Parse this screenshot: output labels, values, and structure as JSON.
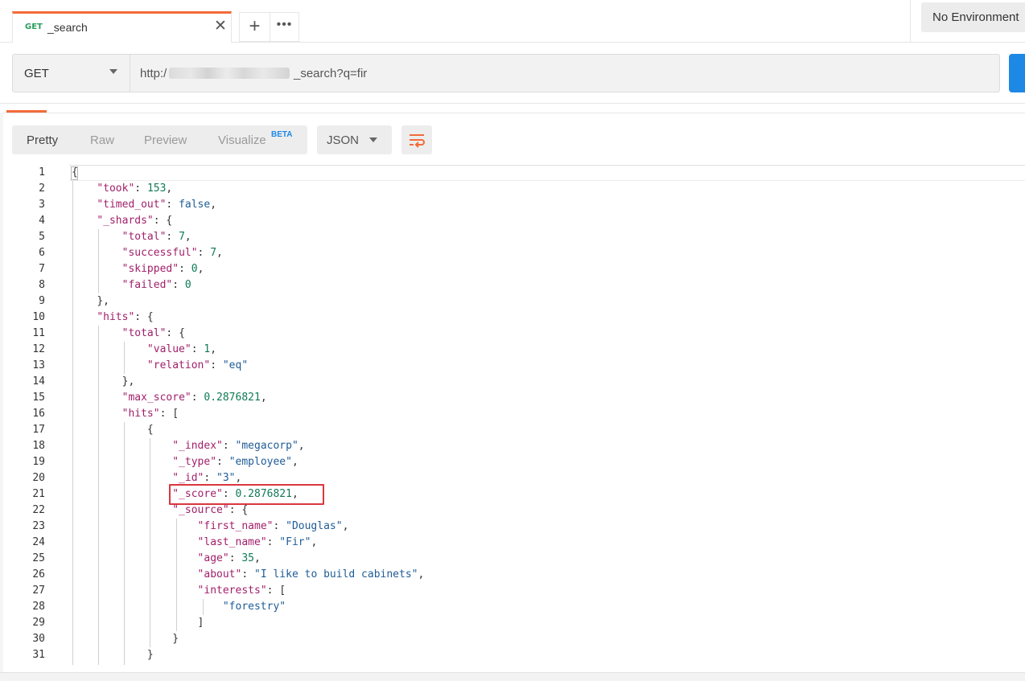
{
  "tab": {
    "method": "GET",
    "title": "_search",
    "close_glyph": "✕",
    "add_glyph": "+",
    "more_glyph": "•••"
  },
  "environment": {
    "label": "No Environment"
  },
  "request": {
    "method": "GET",
    "url_prefix": "http:/",
    "url_suffix": "_search?q=fir"
  },
  "response_toolbar": {
    "tabs": [
      {
        "label": "Pretty",
        "active": true
      },
      {
        "label": "Raw",
        "active": false
      },
      {
        "label": "Preview",
        "active": false
      },
      {
        "label": "Visualize",
        "active": false
      }
    ],
    "beta_label": "BETA",
    "format": "JSON"
  },
  "code_lines": [
    {
      "n": "1",
      "html": "<span class=\"p\">{</span>"
    },
    {
      "n": "2",
      "html": "    <span class=\"k\">\"took\"</span><span class=\"p\">: </span><span class=\"n\">153</span><span class=\"p\">,</span>"
    },
    {
      "n": "3",
      "html": "    <span class=\"k\">\"timed_out\"</span><span class=\"p\">: </span><span class=\"b\">false</span><span class=\"p\">,</span>"
    },
    {
      "n": "4",
      "html": "    <span class=\"k\">\"_shards\"</span><span class=\"p\">: {</span>"
    },
    {
      "n": "5",
      "html": "        <span class=\"k\">\"total\"</span><span class=\"p\">: </span><span class=\"n\">7</span><span class=\"p\">,</span>"
    },
    {
      "n": "6",
      "html": "        <span class=\"k\">\"successful\"</span><span class=\"p\">: </span><span class=\"n\">7</span><span class=\"p\">,</span>"
    },
    {
      "n": "7",
      "html": "        <span class=\"k\">\"skipped\"</span><span class=\"p\">: </span><span class=\"n\">0</span><span class=\"p\">,</span>"
    },
    {
      "n": "8",
      "html": "        <span class=\"k\">\"failed\"</span><span class=\"p\">: </span><span class=\"n\">0</span>"
    },
    {
      "n": "9",
      "html": "    <span class=\"p\">},</span>"
    },
    {
      "n": "10",
      "html": "    <span class=\"k\">\"hits\"</span><span class=\"p\">: {</span>"
    },
    {
      "n": "11",
      "html": "        <span class=\"k\">\"total\"</span><span class=\"p\">: {</span>"
    },
    {
      "n": "12",
      "html": "            <span class=\"k\">\"value\"</span><span class=\"p\">: </span><span class=\"n\">1</span><span class=\"p\">,</span>"
    },
    {
      "n": "13",
      "html": "            <span class=\"k\">\"relation\"</span><span class=\"p\">: </span><span class=\"s\">\"eq\"</span>"
    },
    {
      "n": "14",
      "html": "        <span class=\"p\">},</span>"
    },
    {
      "n": "15",
      "html": "        <span class=\"k\">\"max_score\"</span><span class=\"p\">: </span><span class=\"n\">0.2876821</span><span class=\"p\">,</span>"
    },
    {
      "n": "16",
      "html": "        <span class=\"k\">\"hits\"</span><span class=\"p\">: [</span>"
    },
    {
      "n": "17",
      "html": "            <span class=\"p\">{</span>"
    },
    {
      "n": "18",
      "html": "                <span class=\"k\">\"_index\"</span><span class=\"p\">: </span><span class=\"s\">\"megacorp\"</span><span class=\"p\">,</span>"
    },
    {
      "n": "19",
      "html": "                <span class=\"k\">\"_type\"</span><span class=\"p\">: </span><span class=\"s\">\"employee\"</span><span class=\"p\">,</span>"
    },
    {
      "n": "20",
      "html": "                <span class=\"k\">\"_id\"</span><span class=\"p\">: </span><span class=\"s\">\"3\"</span><span class=\"p\">,</span>"
    },
    {
      "n": "21",
      "html": "                <span class=\"k\">\"_score\"</span><span class=\"p\">: </span><span class=\"n\">0.2876821</span><span class=\"p\">,</span>"
    },
    {
      "n": "22",
      "html": "                <span class=\"k\">\"_source\"</span><span class=\"p\">: {</span>"
    },
    {
      "n": "23",
      "html": "                    <span class=\"k\">\"first_name\"</span><span class=\"p\">: </span><span class=\"s\">\"Douglas\"</span><span class=\"p\">,</span>"
    },
    {
      "n": "24",
      "html": "                    <span class=\"k\">\"last_name\"</span><span class=\"p\">: </span><span class=\"s\">\"Fir\"</span><span class=\"p\">,</span>"
    },
    {
      "n": "25",
      "html": "                    <span class=\"k\">\"age\"</span><span class=\"p\">: </span><span class=\"n\">35</span><span class=\"p\">,</span>"
    },
    {
      "n": "26",
      "html": "                    <span class=\"k\">\"about\"</span><span class=\"p\">: </span><span class=\"s\">\"I like to build cabinets\"</span><span class=\"p\">,</span>"
    },
    {
      "n": "27",
      "html": "                    <span class=\"k\">\"interests\"</span><span class=\"p\">: [</span>"
    },
    {
      "n": "28",
      "html": "                        <span class=\"s\">\"forestry\"</span>"
    },
    {
      "n": "29",
      "html": "                    <span class=\"p\">]</span>"
    },
    {
      "n": "30",
      "html": "                <span class=\"p\">}</span>"
    },
    {
      "n": "31",
      "html": "            <span class=\"p\">}</span>"
    }
  ],
  "colors": {
    "accent": "#f26b3a",
    "send_button": "#1e88e5",
    "highlight_box": "#d9363e",
    "json_key": "#a11f6a",
    "json_string": "#1f5c96",
    "json_number": "#0f7b55"
  }
}
